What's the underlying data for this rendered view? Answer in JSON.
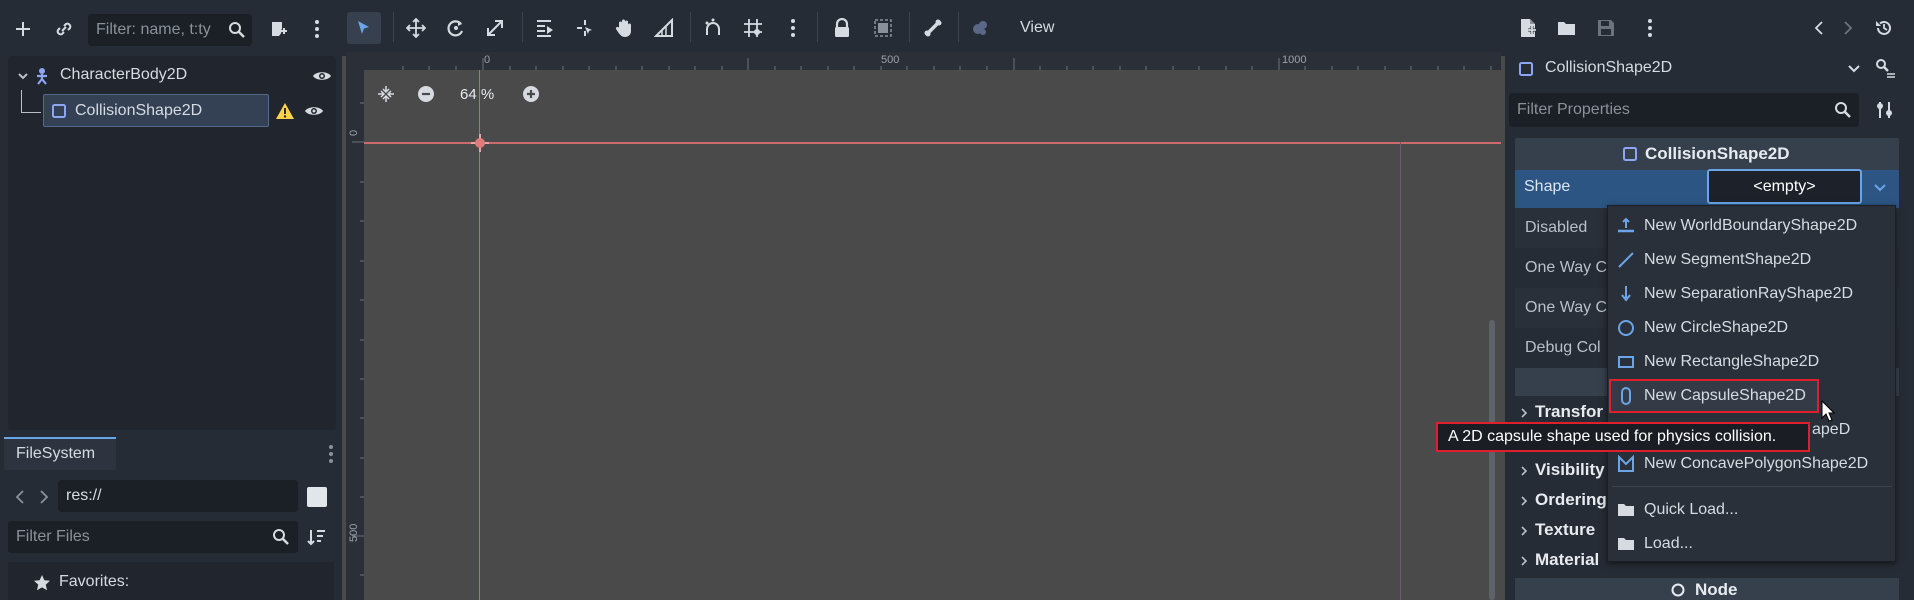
{
  "scene": {
    "filter_placeholder": "Filter: name, t:ty",
    "nodes": [
      {
        "label": "CharacterBody2D"
      },
      {
        "label": "CollisionShape2D"
      }
    ]
  },
  "filesystem": {
    "tab_label": "FileSystem",
    "path": "res://",
    "filter_placeholder": "Filter Files",
    "favorites_label": "Favorites:"
  },
  "viewport": {
    "view_menu": "View",
    "zoom": "64 %",
    "ruler_top": [
      "0",
      "500",
      "1000"
    ],
    "ruler_left": [
      "0",
      "500"
    ]
  },
  "inspector": {
    "node_selector": "CollisionShape2D",
    "filter_placeholder": "Filter Properties",
    "section_title": "CollisionShape2D",
    "shape_label": "Shape",
    "shape_value": "<empty>",
    "properties": [
      "Disabled",
      "One Way C",
      "One Way C",
      "Debug Col"
    ],
    "groups": [
      "Transfor",
      "Visibility",
      "Ordering",
      "Texture",
      "Material"
    ],
    "bottom_section": "Node"
  },
  "shape_menu": {
    "items": [
      {
        "label": "New WorldBoundaryShape2D",
        "icon": "world-boundary-icon"
      },
      {
        "label": "New SegmentShape2D",
        "icon": "segment-icon"
      },
      {
        "label": "New SeparationRayShape2D",
        "icon": "separation-ray-icon"
      },
      {
        "label": "New CircleShape2D",
        "icon": "circle-icon"
      },
      {
        "label": "New RectangleShape2D",
        "icon": "rectangle-icon"
      },
      {
        "label": "New CapsuleShape2D",
        "icon": "capsule-icon"
      },
      {
        "label": "apeD",
        "icon": "convex-polygon-icon"
      },
      {
        "label": "New ConcavePolygonShape2D",
        "icon": "concave-polygon-icon"
      },
      {
        "label": "Quick Load...",
        "icon": "folder-icon"
      },
      {
        "label": "Load...",
        "icon": "folder-icon"
      }
    ],
    "highlighted": "New CapsuleShape2D"
  },
  "tooltip": "A 2D capsule shape used for physics collision.",
  "colors": {
    "accent": "#6aa5e8",
    "highlight_border": "#e01f2d",
    "warning": "#ffd24a"
  }
}
